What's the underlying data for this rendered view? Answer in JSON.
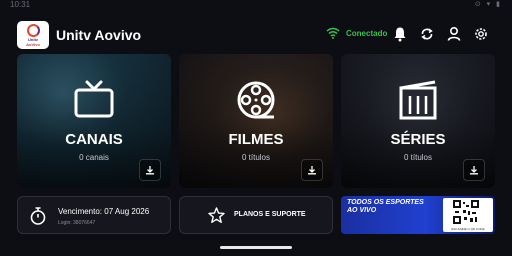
{
  "status_bar": {
    "time": "10:31",
    "indicators": "⊙ ▾ ▮"
  },
  "header": {
    "logo_text": "Unitv",
    "logo_subtext": "AoVivo",
    "title": "Unitv Aovivo",
    "connection_status": "Conectado",
    "connection_color": "#37c24a"
  },
  "cards": [
    {
      "label": "CANAIS",
      "count": "0 canais",
      "icon": "tv-icon"
    },
    {
      "label": "FILMES",
      "count": "0 títulos",
      "icon": "film-reel-icon"
    },
    {
      "label": "SÉRIES",
      "count": "0 títulos",
      "icon": "clapperboard-icon"
    }
  ],
  "expiry": {
    "label": "Vencimento:  07 Aug 2026",
    "login": "Login: 38076647"
  },
  "plans": {
    "label": "PLANOS E SUPORTE"
  },
  "banner": {
    "headline": "TODOS OS ESPORTES AO VIVO",
    "qr_caption": "ESCANEIE O QR CODE"
  }
}
